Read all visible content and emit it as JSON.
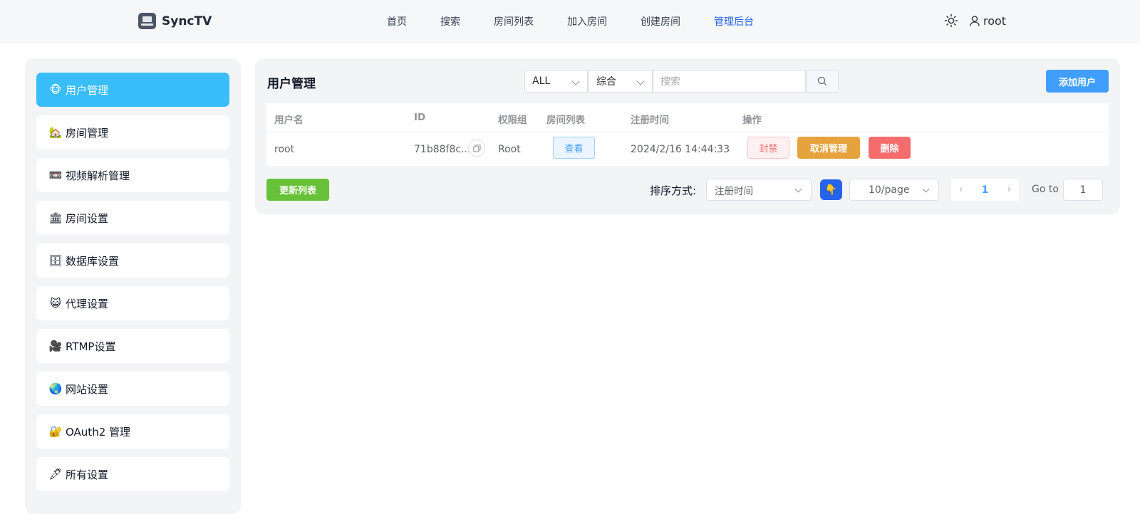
{
  "header": {
    "logo_text": "SyncTV",
    "nav": [
      "首页",
      "搜索",
      "房间列表",
      "加入房间",
      "创建房间",
      "管理后台"
    ],
    "active_nav": "管理后台",
    "user_name": "root"
  },
  "sidebar": {
    "items": [
      {
        "icon": "🐵",
        "label": "用户管理"
      },
      {
        "icon": "🏡",
        "label": "房间管理"
      },
      {
        "icon": "📼",
        "label": "视频解析管理"
      },
      {
        "icon": "🏛",
        "label": "房间设置"
      },
      {
        "icon": "🗄",
        "label": "数据库设置"
      },
      {
        "icon": "😺",
        "label": "代理设置"
      },
      {
        "icon": "🎥",
        "label": "RTMP设置"
      },
      {
        "icon": "🌏",
        "label": "网站设置"
      },
      {
        "icon": "🔐",
        "label": "OAuth2 管理"
      },
      {
        "icon": "🖋",
        "label": "所有设置"
      }
    ],
    "active_index": 0
  },
  "main": {
    "title": "用户管理",
    "filter_role": "ALL",
    "filter_field": "综合",
    "search_placeholder": "搜索",
    "add_user_label": "添加用户",
    "table": {
      "headers": [
        "用户名",
        "ID",
        "权限组",
        "房间列表",
        "注册时间",
        "操作"
      ],
      "rows": [
        {
          "username": "root",
          "id": "71b88f8c...",
          "role": "Root",
          "rooms_label": "查看",
          "registered": "2024/2/16 14:44:33",
          "actions": [
            "封禁",
            "取消管理",
            "删除"
          ]
        }
      ]
    },
    "refresh_label": "更新列表",
    "sort_label": "排序方式:",
    "sort_value": "注册时间",
    "order_icon": "👇",
    "page_size": "10/page",
    "current_page": "1",
    "goto_label": "Go to",
    "goto_value": "1"
  }
}
